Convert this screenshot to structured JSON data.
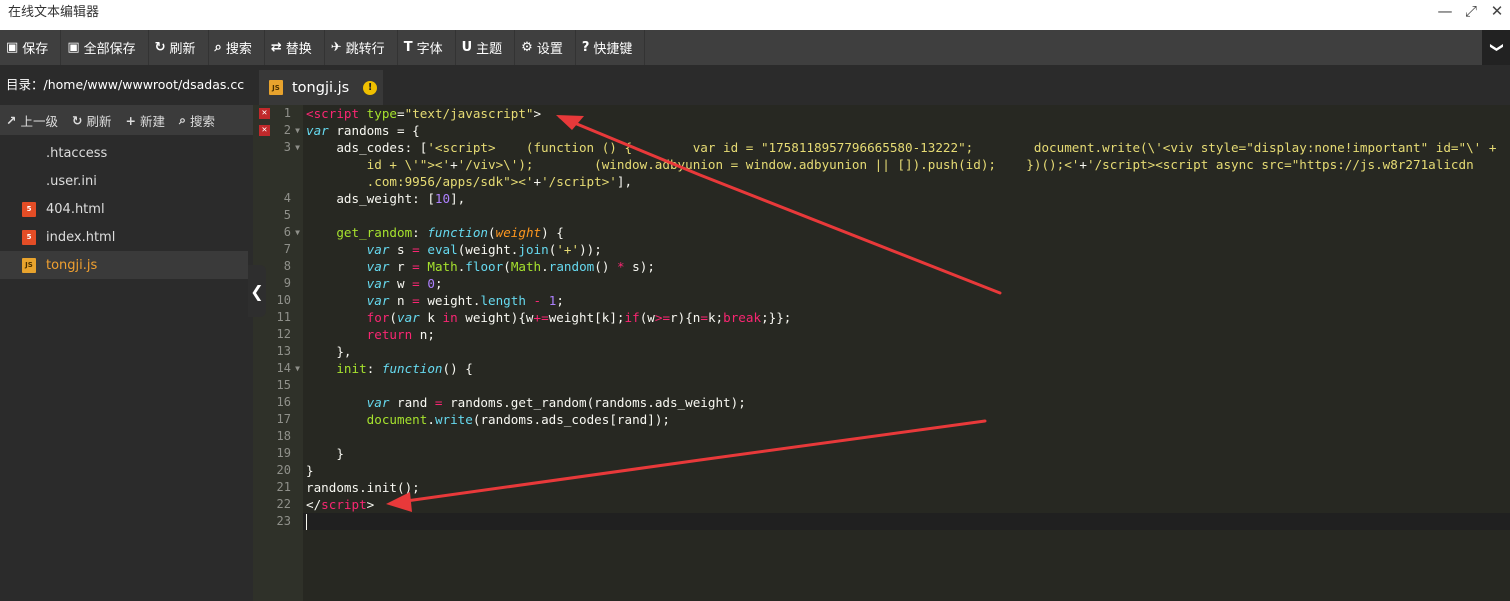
{
  "window": {
    "title": "在线文本编辑器",
    "minimize": "—",
    "maximize": "⤢",
    "close": "✕"
  },
  "toolbar": {
    "buttons": [
      {
        "id": "save",
        "icon": "floppy-icon",
        "glyph": "▣",
        "label": "保存"
      },
      {
        "id": "save-all",
        "icon": "floppy-stack-icon",
        "glyph": "▣",
        "label": "全部保存"
      },
      {
        "id": "refresh",
        "icon": "refresh-icon",
        "glyph": "↻",
        "label": "刷新"
      },
      {
        "id": "search",
        "icon": "search-icon",
        "glyph": "⌕",
        "label": "搜索"
      },
      {
        "id": "replace",
        "icon": "replace-icon",
        "glyph": "⇄",
        "label": "替换"
      },
      {
        "id": "goto-line",
        "icon": "pin-icon",
        "glyph": "✈",
        "label": "跳转行"
      },
      {
        "id": "font",
        "icon": "text-icon",
        "glyph": "T",
        "label": "字体"
      },
      {
        "id": "theme",
        "icon": "magnet-icon",
        "glyph": "U",
        "label": "主题"
      },
      {
        "id": "settings",
        "icon": "gear-icon",
        "glyph": "⚙",
        "label": "设置"
      },
      {
        "id": "shortcuts",
        "icon": "question-icon",
        "glyph": "?",
        "label": "快捷键"
      }
    ],
    "collapse_glyph": "❯"
  },
  "sidebar": {
    "directory_label": "目录：/home/www/wwwroot/dsadas.cc",
    "tools": [
      {
        "id": "up",
        "glyph": "↗",
        "label": "上一级"
      },
      {
        "id": "refresh",
        "glyph": "↻",
        "label": "刷新"
      },
      {
        "id": "new",
        "glyph": "+",
        "label": "新建"
      },
      {
        "id": "search",
        "glyph": "⌕",
        "label": "搜索"
      }
    ],
    "files": [
      {
        "name": ".htaccess",
        "type": "blank",
        "badge": ""
      },
      {
        "name": ".user.ini",
        "type": "blank",
        "badge": ""
      },
      {
        "name": "404.html",
        "type": "html",
        "badge": "5"
      },
      {
        "name": "index.html",
        "type": "html",
        "badge": "5"
      },
      {
        "name": "tongji.js",
        "type": "js",
        "badge": "JS"
      }
    ],
    "handle_glyph": "❮"
  },
  "editor": {
    "active_tab": {
      "name": "tongji.js",
      "badge": "JS",
      "warning": "!"
    },
    "line_numbers": [
      "1",
      "2",
      "3",
      "",
      "",
      "4",
      "5",
      "6",
      "7",
      "8",
      "9",
      "10",
      "11",
      "12",
      "13",
      "14",
      "15",
      "16",
      "17",
      "18",
      "19",
      "20",
      "21",
      "22",
      "23"
    ],
    "error_lines": [
      1,
      2
    ],
    "fold_lines": [
      2,
      3,
      6,
      14
    ],
    "cursor_line": 23
  },
  "colors": {
    "tag": "#f92672",
    "attr": "#a6e22e",
    "string": "#e6db74",
    "keyword": "#66d9ef",
    "number": "#ae81ff",
    "param": "#fd971f",
    "text": "#f8f8f2",
    "annotation_arrow": "#e8393a"
  }
}
